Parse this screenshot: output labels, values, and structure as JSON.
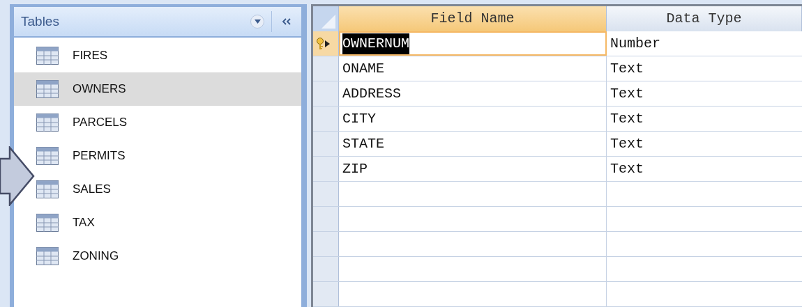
{
  "nav_pane": {
    "title": "Tables",
    "items": [
      {
        "label": "FIRES",
        "selected": false
      },
      {
        "label": "OWNERS",
        "selected": true
      },
      {
        "label": "PARCELS",
        "selected": false
      },
      {
        "label": "PERMITS",
        "selected": false
      },
      {
        "label": "SALES",
        "selected": false
      },
      {
        "label": "TAX",
        "selected": false
      },
      {
        "label": "ZONING",
        "selected": false
      }
    ]
  },
  "design_grid": {
    "columns": [
      "Field Name",
      "Data Type"
    ],
    "rows": [
      {
        "field_name": "OWNERNUM",
        "data_type": "Number",
        "primary_key": true,
        "current": true
      },
      {
        "field_name": "ONAME",
        "data_type": "Text",
        "primary_key": false,
        "current": false
      },
      {
        "field_name": "ADDRESS",
        "data_type": "Text",
        "primary_key": false,
        "current": false
      },
      {
        "field_name": "CITY",
        "data_type": "Text",
        "primary_key": false,
        "current": false
      },
      {
        "field_name": "STATE",
        "data_type": "Text",
        "primary_key": false,
        "current": false
      },
      {
        "field_name": "ZIP",
        "data_type": "Text",
        "primary_key": false,
        "current": false
      }
    ]
  }
}
